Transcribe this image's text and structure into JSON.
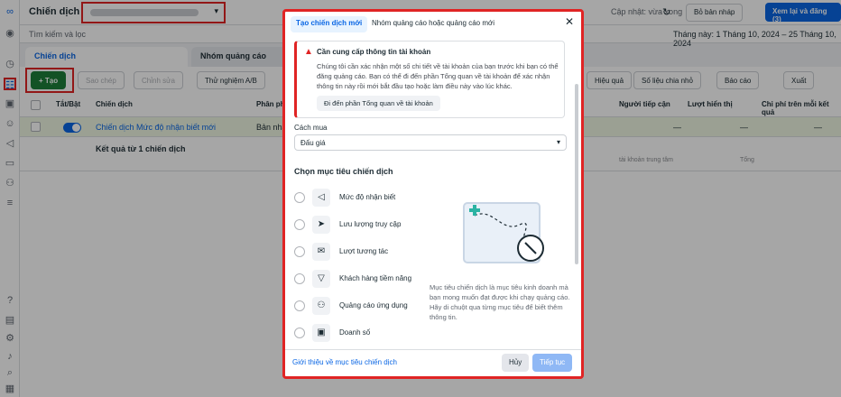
{
  "topbar": {
    "title": "Chiến dịch",
    "updated": "Cập nhật: vừa xong",
    "draft": "Bỏ bản nháp",
    "publish": "Xem lại và đăng (3)"
  },
  "search": {
    "placeholder": "Tìm kiếm và lọc"
  },
  "daterange": "Tháng này: 1 Tháng 10, 2024 – 25 Tháng 10, 2024",
  "tabs": {
    "campaigns": "Chiến dịch",
    "adsets": "Nhóm quảng cáo"
  },
  "toolbar": {
    "create": "+ Tạo",
    "duplicate": "Sao chép",
    "edit": "Chỉnh sửa",
    "abtest": "Thử nghiệm A/B",
    "results": "Hiệu quả",
    "breakdown": "Số liệu chia nhỏ",
    "reports": "Báo cáo",
    "export": "Xuất"
  },
  "table": {
    "headers": [
      "Tắt/Bật",
      "Chiến dịch",
      "Phân phối",
      "Người tiếp cận",
      "Lượt hiển thị",
      "Chi phí trên mỗi kết quả"
    ],
    "row1": {
      "name": "Chiến dịch Mức độ nhận biết mới",
      "delivery": "Bản nháp",
      "reach": "—",
      "impr": "—",
      "cost": "—"
    },
    "row2": {
      "summary": "Kết quả từ 1 chiến dịch",
      "reach_note": "tài khoản trung tâm",
      "impr_note": "Tổng"
    }
  },
  "modal": {
    "tab_new": "Tạo chiến dịch mới",
    "tab_existing": "Nhóm quảng cáo hoặc quảng cáo mới",
    "alert_title": "Cần cung cấp thông tin tài khoản",
    "alert_body": "Chúng tôi cần xác nhận một số chi tiết về tài khoản của bạn trước khi bạn có thể đăng quảng cáo. Bạn có thể đi đến phần Tổng quan về tài khoản để xác nhận thông tin này rồi mới bắt đầu tạo hoặc làm điều này vào lúc khác.",
    "alert_button": "Đi đến phần Tổng quan về tài khoản",
    "buy_label": "Cách mua",
    "buy_value": "Đấu giá",
    "objective_title": "Chọn mục tiêu chiến dịch",
    "objectives": [
      {
        "label": "Mức độ nhận biết",
        "icon": "megaphone-icon"
      },
      {
        "label": "Lưu lượng truy cập",
        "icon": "cursor-icon"
      },
      {
        "label": "Lượt tương tác",
        "icon": "chat-icon"
      },
      {
        "label": "Khách hàng tiềm năng",
        "icon": "funnel-icon"
      },
      {
        "label": "Quảng cáo ứng dụng",
        "icon": "people-icon"
      },
      {
        "label": "Doanh số",
        "icon": "briefcase-icon"
      }
    ],
    "description": "Mục tiêu chiến dịch là mục tiêu kinh doanh mà bạn mong muốn đạt được khi chạy quảng cáo. Hãy di chuột qua từng mục tiêu để biết thêm thông tin.",
    "learn_more": "Giới thiệu về mục tiêu chiến dịch",
    "cancel": "Hủy",
    "continue": "Tiếp tục"
  },
  "colors": {
    "accent": "#0a66e4",
    "create": "#1e7f3a",
    "highlight": "#e02424"
  }
}
